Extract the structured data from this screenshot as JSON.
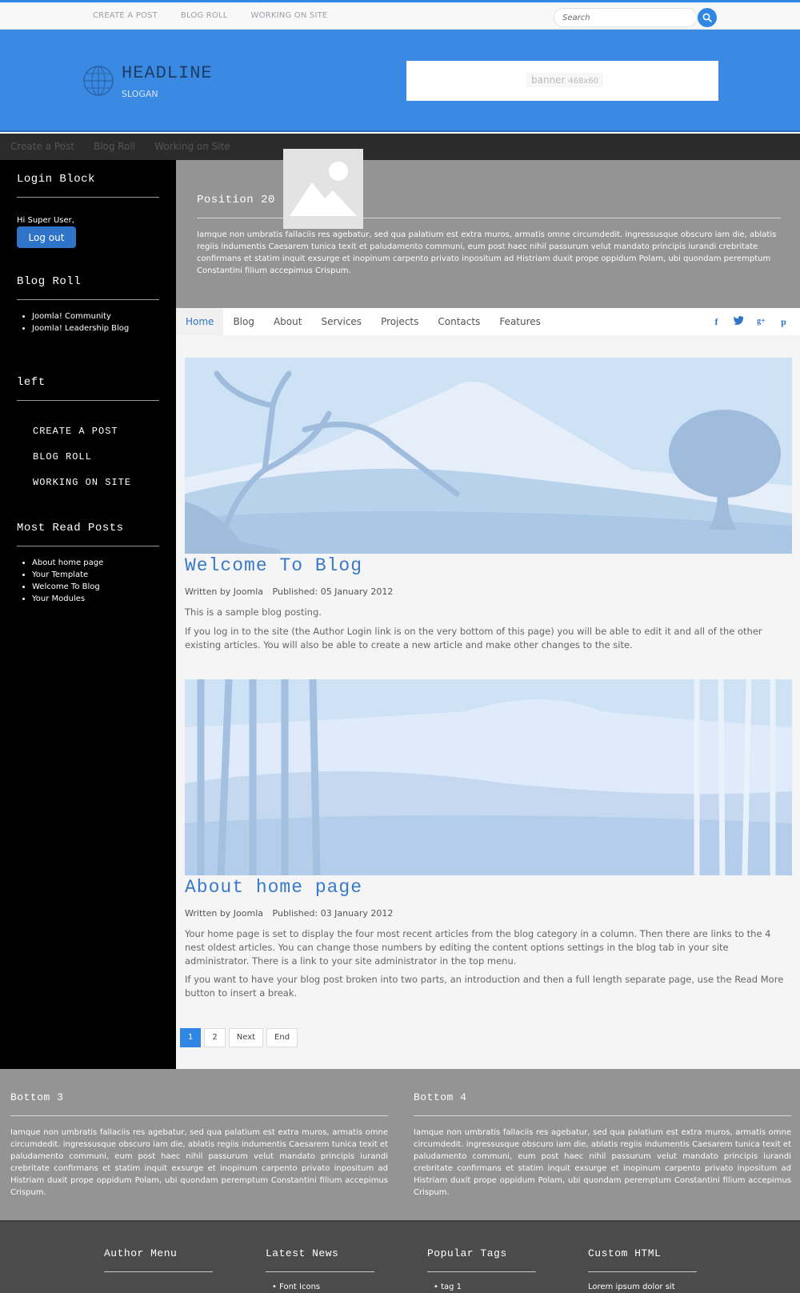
{
  "topbar": {
    "nav": [
      "CREATE A POST",
      "BLOG ROLL",
      "WORKING ON SITE"
    ],
    "search_placeholder": "Search"
  },
  "header": {
    "headline": "HEADLINE",
    "slogan": "SLOGAN",
    "banner_label": "banner",
    "banner_size": "468x60"
  },
  "darknav": {
    "items": [
      "Create a Post",
      "Blog Roll",
      "Working on Site"
    ]
  },
  "sidebar": {
    "login": {
      "title": "Login Block",
      "greeting": "Hi Super User,",
      "logout_label": "Log out"
    },
    "blogroll": {
      "title": "Blog Roll",
      "items": [
        "Joomla! Community",
        "Joomla! Leadership Blog"
      ]
    },
    "left": {
      "title": "left",
      "items": [
        "CREATE A POST",
        "BLOG ROLL",
        "WORKING ON SITE"
      ]
    },
    "most_read": {
      "title": "Most Read Posts",
      "items": [
        "About home page",
        "Your Template",
        "Welcome To Blog",
        "Your Modules"
      ]
    }
  },
  "position20": {
    "title": "Position 20",
    "text": "Iamque non umbratis fallaciis res agebatur, sed qua palatium est extra muros, armatis omne circumdedit. ingressusque obscuro iam die, ablatis regiis indumentis Caesarem tunica texit et paludamento communi, eum post haec nihil passurum velut mandato principis iurandi crebritate confirmans et statim inquit exsurge et inopinum carpento privato inpositum ad Histriam duxit prope oppidum Polam, ubi quondam peremptum Constantini filium accepimus Crispum."
  },
  "mainnav": {
    "items": [
      "Home",
      "Blog",
      "About",
      "Services",
      "Projects",
      "Contacts",
      "Features"
    ],
    "social": [
      "f",
      "t",
      "g+",
      "p"
    ]
  },
  "articles": [
    {
      "title": "Welcome To Blog",
      "author": "Written by Joomla",
      "published": "Published: 05 January 2012",
      "paragraphs": [
        "This is a sample blog posting.",
        "If you log in to the site (the Author Login link is on the very bottom of this page) you will be able to edit it and all of the other existing articles. You will also be able to create a new article and make other changes to the site."
      ]
    },
    {
      "title": "About home page",
      "author": "Written by Joomla",
      "published": "Published: 03 January 2012",
      "paragraphs": [
        "Your home page is set to display the four most recent articles from the blog category in a column. Then there are links to the 4 nest oldest articles. You can change those numbers by editing the content options settings in the blog tab in your site administrator. There is a link to your site administrator in the top menu.",
        "If you want to have your blog post broken into two parts, an introduction and then a full length separate page, use the Read More button to insert a break."
      ]
    }
  ],
  "pager": [
    "1",
    "2",
    "Next",
    "End"
  ],
  "bottom": [
    {
      "title": "Bottom 3",
      "text": "Iamque non umbratis fallaciis res agebatur, sed qua palatium est extra muros, armatis omne circumdedit. ingressusque obscuro iam die, ablatis regiis indumentis Caesarem tunica texit et paludamento communi, eum post haec nihil passurum velut mandato principis iurandi crebritate confirmans et statim inquit exsurge et inopinum carpento privato inpositum ad Histriam duxit prope oppidum Polam, ubi quondam peremptum Constantini filium accepimus Crispum."
    },
    {
      "title": "Bottom 4",
      "text": "Iamque non umbratis fallaciis res agebatur, sed qua palatium est extra muros, armatis omne circumdedit. ingressusque obscuro iam die, ablatis regiis indumentis Caesarem tunica texit et paludamento communi, eum post haec nihil passurum velut mandato principis iurandi crebritate confirmans et statim inquit exsurge et inopinum carpento privato inpositum ad Histriam duxit prope oppidum Polam, ubi quondam peremptum Constantini filium accepimus Crispum."
    }
  ],
  "footer": [
    {
      "title": "Author Menu",
      "item": ""
    },
    {
      "title": "Latest News",
      "item": "Font Icons"
    },
    {
      "title": "Popular Tags",
      "item": "tag 1"
    },
    {
      "title": "Custom HTML",
      "item": "Lorem ipsum dolor sit"
    }
  ],
  "colors": {
    "accent": "#2f86e3",
    "header": "#3a89e3",
    "sidebar": "#000000",
    "panel": "#949494"
  }
}
